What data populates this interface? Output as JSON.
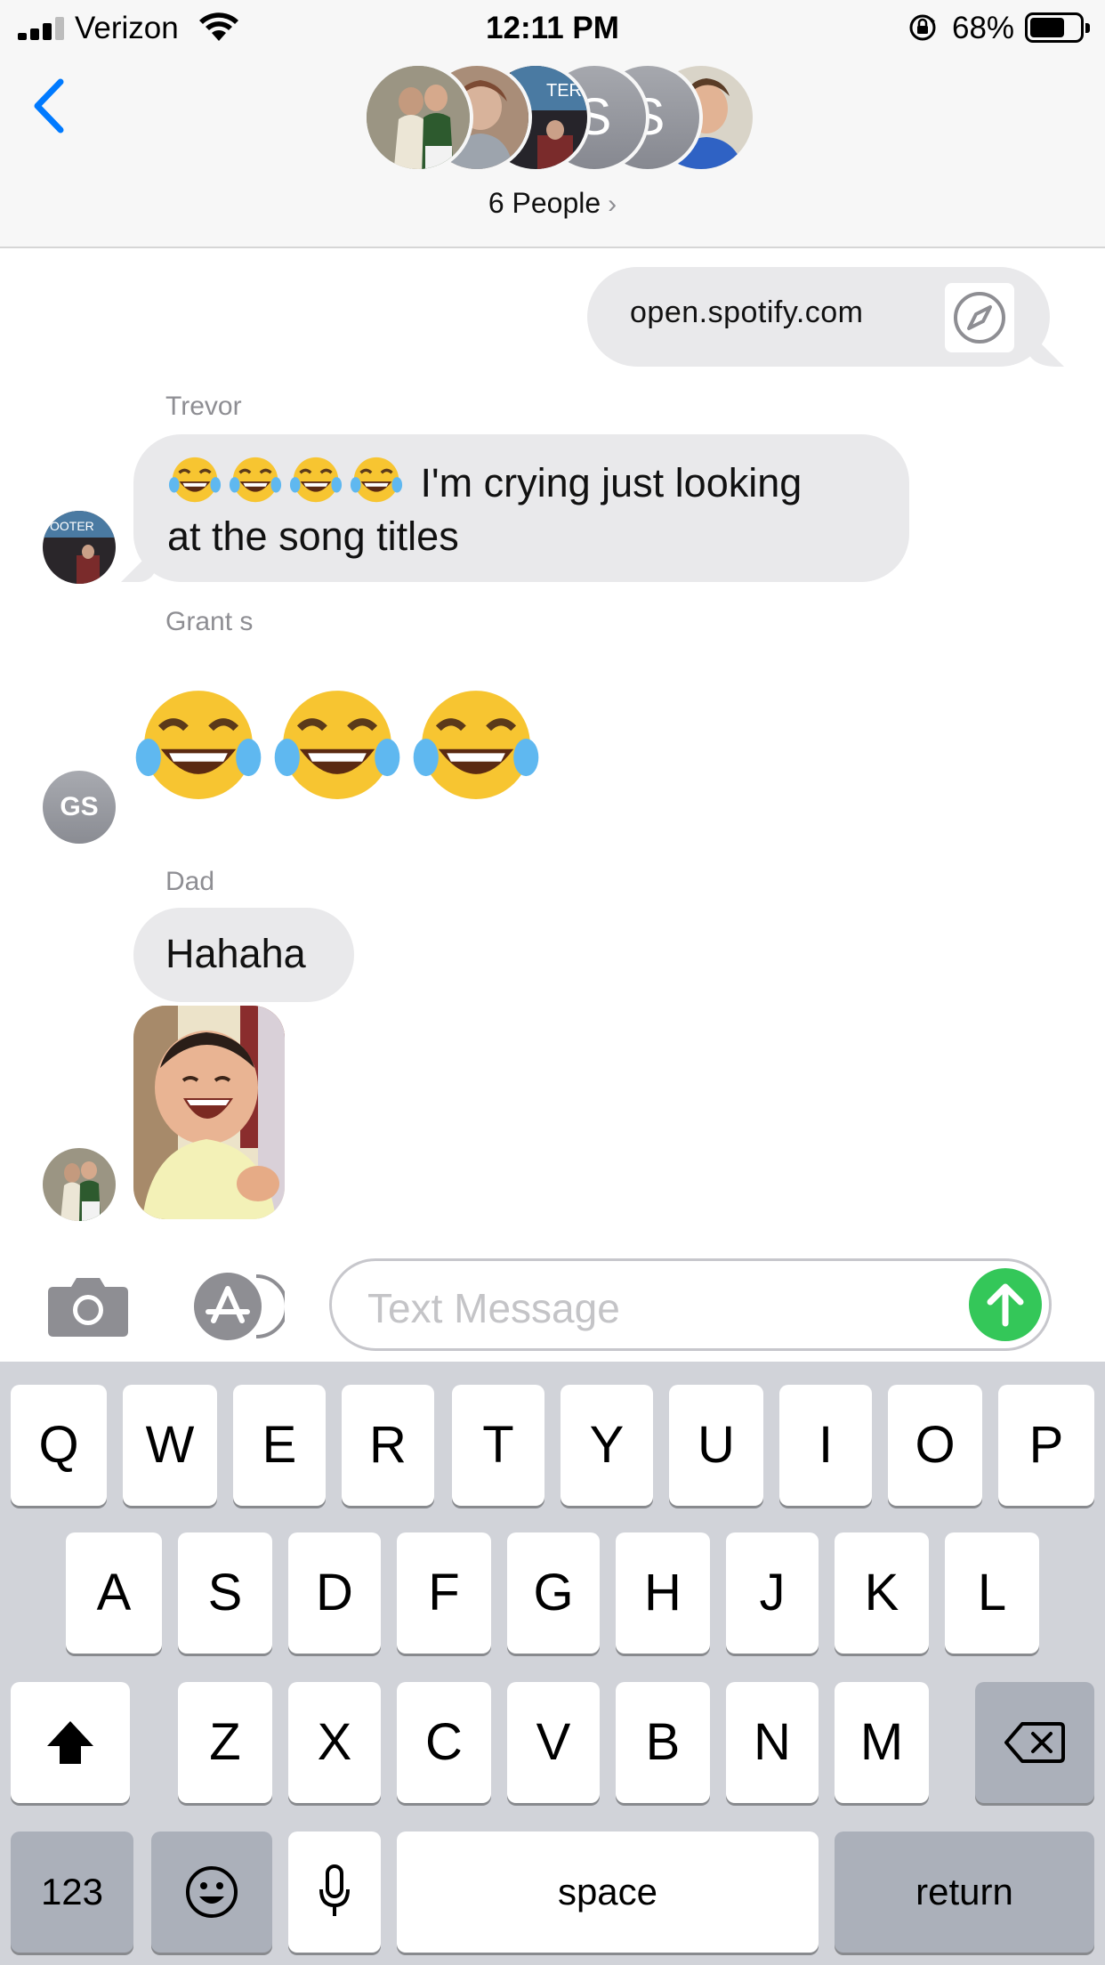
{
  "status_bar": {
    "carrier": "Verizon",
    "time": "12:11 PM",
    "battery_percent": "68%"
  },
  "header": {
    "avatar_letters": [
      "S",
      "S"
    ],
    "group_label": "6 People",
    "group_chevron": "›"
  },
  "messages": {
    "link_preview": {
      "text": "open.spotify.com",
      "icon": "compass-icon"
    },
    "trevor": {
      "sender": "Trevor",
      "text_line1": "I'm crying just looking",
      "text_line2": "at the song titles",
      "emoji": "face-with-tears-of-joy x4"
    },
    "grant": {
      "sender": "Grant s",
      "avatar_initials": "GS",
      "emoji": "face-with-tears-of-joy x3"
    },
    "dad": {
      "sender": "Dad",
      "text": "Hahaha",
      "attachment": "laughing-baby-gif"
    }
  },
  "input": {
    "placeholder": "Text Message"
  },
  "keyboard": {
    "row1": [
      "Q",
      "W",
      "E",
      "R",
      "T",
      "Y",
      "U",
      "I",
      "O",
      "P"
    ],
    "row2": [
      "A",
      "S",
      "D",
      "F",
      "G",
      "H",
      "J",
      "K",
      "L"
    ],
    "row3": [
      "Z",
      "X",
      "C",
      "V",
      "B",
      "N",
      "M"
    ],
    "numbers_label": "123",
    "space_label": "space",
    "return_label": "return"
  },
  "colors": {
    "bubble_gray": "#e9e9eb",
    "send_green": "#34c759",
    "ios_blue": "#007aff",
    "keyboard_bg": "#d1d3d9"
  }
}
